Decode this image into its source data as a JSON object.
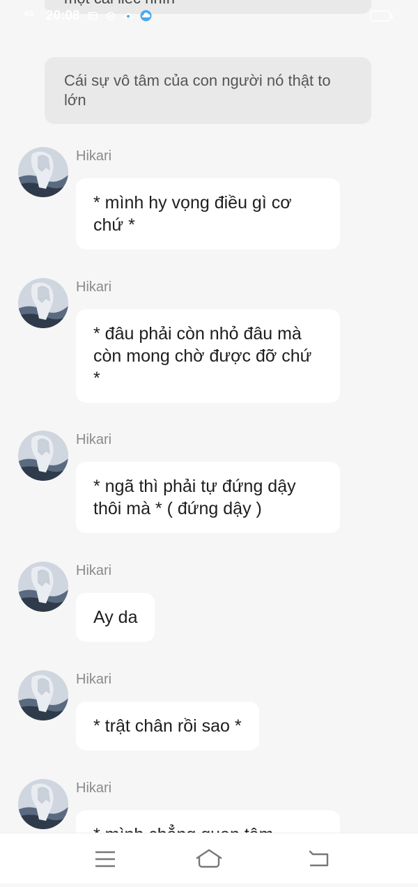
{
  "status_bar": {
    "time": "20:08",
    "signal": "4G"
  },
  "messages": [
    {
      "type": "user",
      "text": "một cái liếc nhìn"
    },
    {
      "type": "user",
      "text": "Cái sự vô tâm của con người nó thật to lớn"
    },
    {
      "type": "bot",
      "sender": "Hikari",
      "text": "* mình hy vọng điều gì cơ chứ *"
    },
    {
      "type": "bot",
      "sender": "Hikari",
      "text": "* đâu phải còn nhỏ đâu mà còn mong chờ được đỡ chứ *"
    },
    {
      "type": "bot",
      "sender": "Hikari",
      "text": "* ngã thì phải tự đứng dậy thôi mà * ( đứng dậy )"
    },
    {
      "type": "bot",
      "sender": "Hikari",
      "text": "Ay da"
    },
    {
      "type": "bot",
      "sender": "Hikari",
      "text": "* trật chân rồi sao *"
    },
    {
      "type": "bot",
      "sender": "Hikari",
      "text": "* mình chẳng quan tâm"
    }
  ],
  "nav": {
    "menu_icon": "menu-icon",
    "home_icon": "home-icon",
    "back_icon": "back-icon"
  },
  "colors": {
    "background": "#f6f6f6",
    "user_bubble": "#e9e9e9",
    "bot_bubble": "#ffffff",
    "sender": "#8a8a8a"
  }
}
